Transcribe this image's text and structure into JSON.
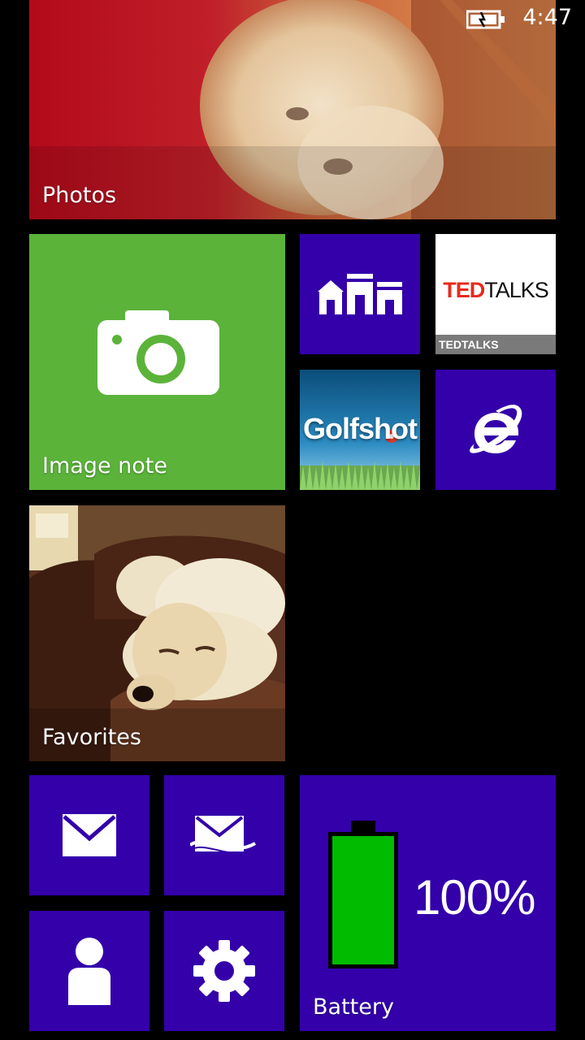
{
  "status_bar": {
    "time": "4:47",
    "battery_icon": "battery-charging-icon"
  },
  "tiles": {
    "photos": {
      "label": "Photos",
      "icon": "photo-image"
    },
    "image_note": {
      "label": "Image note",
      "icon": "camera-icon",
      "color": "#5bb33a"
    },
    "store": {
      "icon": "store-icon",
      "color": "#3300aa"
    },
    "tedtalks": {
      "logo_red": "TED",
      "logo_black": "TALKS",
      "label": "TEDTALKS"
    },
    "golfshot": {
      "logo": "Golfshot"
    },
    "internet_explorer": {
      "icon": "internet-explorer-icon",
      "color": "#3300aa"
    },
    "favorites": {
      "label": "Favorites",
      "icon": "photo-image"
    },
    "mail": {
      "icon": "mail-icon"
    },
    "outlook": {
      "icon": "outlook-icon"
    },
    "people": {
      "icon": "person-icon"
    },
    "settings": {
      "icon": "gear-icon"
    },
    "battery": {
      "label": "Battery",
      "percent": "100%",
      "level": 1.0,
      "fill_color": "#00bb00"
    }
  }
}
